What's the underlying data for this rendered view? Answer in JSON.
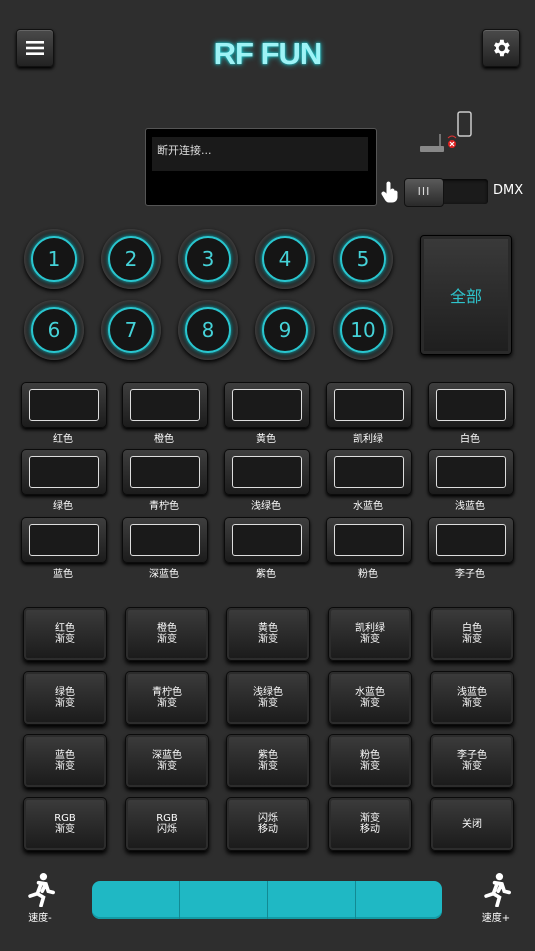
{
  "header": {
    "title": "RF FUN",
    "menu_icon": "menu-icon",
    "settings_icon": "gear-icon"
  },
  "status": {
    "text": "断开连接..."
  },
  "mode": {
    "dmx_label": "DMX",
    "knob_label": "III"
  },
  "zones": {
    "numbers": [
      "1",
      "2",
      "3",
      "4",
      "5",
      "6",
      "7",
      "8",
      "9",
      "10"
    ],
    "all_label": "全部"
  },
  "colors": [
    "红色",
    "橙色",
    "黄色",
    "凯利绿",
    "白色",
    "绿色",
    "青柠色",
    "浅绿色",
    "水蓝色",
    "浅蓝色",
    "蓝色",
    "深蓝色",
    "紫色",
    "粉色",
    "李子色"
  ],
  "gradients": [
    [
      "红色",
      "渐变"
    ],
    [
      "橙色",
      "渐变"
    ],
    [
      "黄色",
      "渐变"
    ],
    [
      "凯利绿",
      "渐变"
    ],
    [
      "白色",
      "渐变"
    ],
    [
      "绿色",
      "渐变"
    ],
    [
      "青柠色",
      "渐变"
    ],
    [
      "浅绿色",
      "渐变"
    ],
    [
      "水蓝色",
      "渐变"
    ],
    [
      "浅蓝色",
      "渐变"
    ],
    [
      "蓝色",
      "渐变"
    ],
    [
      "深蓝色",
      "渐变"
    ],
    [
      "紫色",
      "渐变"
    ],
    [
      "粉色",
      "渐变"
    ],
    [
      "李子色",
      "渐变"
    ],
    [
      "RGB",
      "渐变"
    ],
    [
      "RGB",
      "闪烁"
    ],
    [
      "闪烁",
      "移动"
    ],
    [
      "渐变",
      "移动"
    ],
    [
      "关闭",
      ""
    ]
  ],
  "speed": {
    "down_label": "速度-",
    "up_label": "速度+",
    "segments": 4
  },
  "accent": "#29c6cf"
}
